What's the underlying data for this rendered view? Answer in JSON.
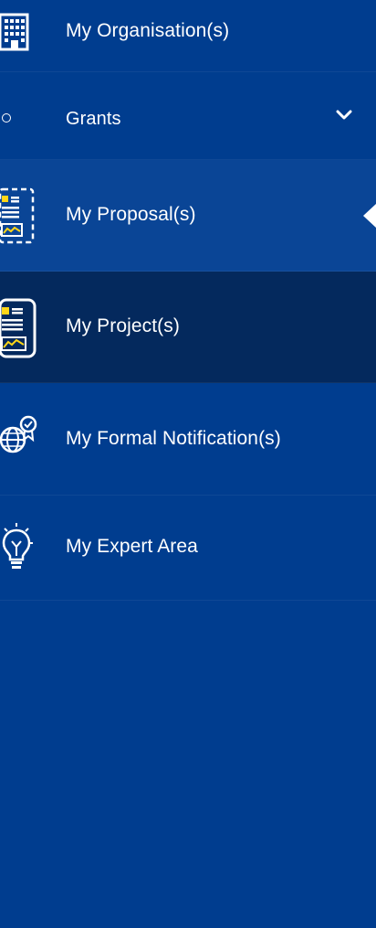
{
  "colors": {
    "background": "#003d8f",
    "active_item": "#04295d",
    "hover_item": "#0a4596",
    "icon_accent": "#ffd617",
    "text": "#ffffff"
  },
  "sidebar": {
    "items": [
      {
        "label": "My Organisation(s)",
        "icon": "building-icon"
      },
      {
        "label": "Grants",
        "icon": "circle-bullet-icon",
        "expand_icon": "chevron-down-icon",
        "expanded": true
      },
      {
        "label": "My Proposal(s)",
        "icon": "proposal-document-icon",
        "current": true
      },
      {
        "label": "My Project(s)",
        "icon": "project-document-icon",
        "selected": true
      },
      {
        "label": "My Formal Notification(s)",
        "icon": "globe-badge-icon"
      },
      {
        "label": "My Expert Area",
        "icon": "lightbulb-icon"
      }
    ]
  }
}
